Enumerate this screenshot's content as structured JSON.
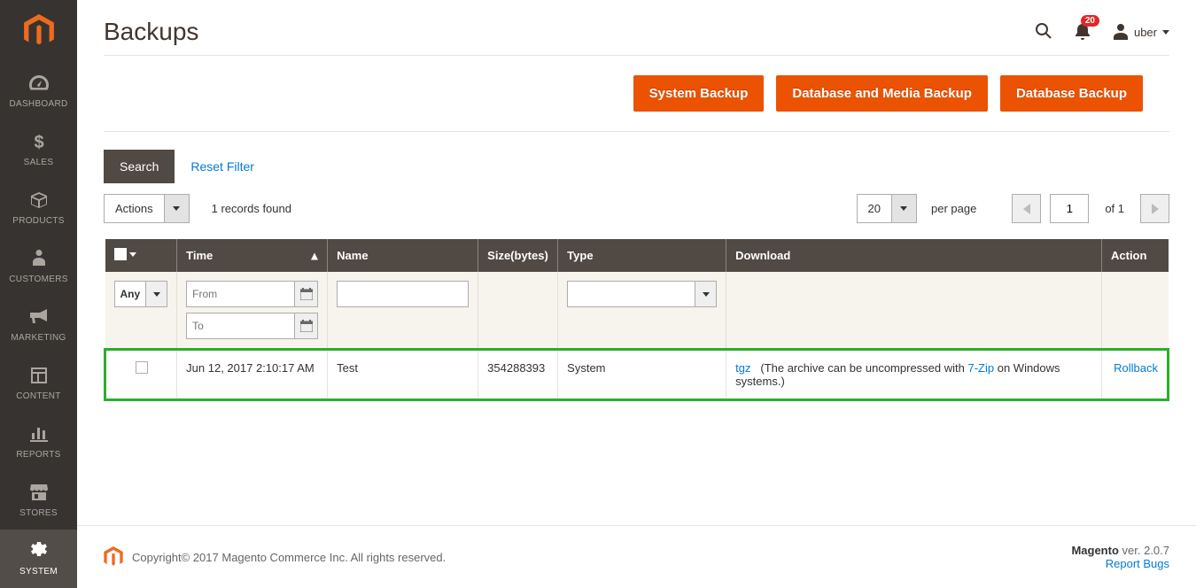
{
  "sidebar": {
    "items": [
      {
        "label": "DASHBOARD"
      },
      {
        "label": "SALES"
      },
      {
        "label": "PRODUCTS"
      },
      {
        "label": "CUSTOMERS"
      },
      {
        "label": "MARKETING"
      },
      {
        "label": "CONTENT"
      },
      {
        "label": "REPORTS"
      },
      {
        "label": "STORES"
      },
      {
        "label": "SYSTEM"
      }
    ]
  },
  "header": {
    "title": "Backups",
    "notif_count": "20",
    "user_name": "uber"
  },
  "actions": {
    "system_backup": "System Backup",
    "db_media_backup": "Database and Media Backup",
    "db_backup": "Database Backup"
  },
  "toolbar": {
    "search": "Search",
    "reset": "Reset Filter",
    "actions_dd": "Actions",
    "records_found": "1 records found",
    "page_size": "20",
    "per_page": "per page",
    "page_current": "1",
    "page_of": "of 1"
  },
  "table": {
    "headers": {
      "time": "Time",
      "name": "Name",
      "size": "Size(bytes)",
      "type": "Type",
      "download": "Download",
      "action": "Action"
    },
    "filters": {
      "any": "Any",
      "from_ph": "From",
      "to_ph": "To"
    },
    "row": {
      "time": "Jun 12, 2017 2:10:17 AM",
      "name": "Test",
      "size": "354288393",
      "type": "System",
      "dl_ext": "tgz",
      "dl_text1": "(The archive can be uncompressed with ",
      "dl_link": "7-Zip",
      "dl_text2": " on Windows systems.)",
      "action": "Rollback"
    }
  },
  "footer": {
    "copyright": "Copyright© 2017 Magento Commerce Inc. All rights reserved.",
    "brand": "Magento",
    "version": " ver. 2.0.7",
    "report": "Report Bugs"
  }
}
